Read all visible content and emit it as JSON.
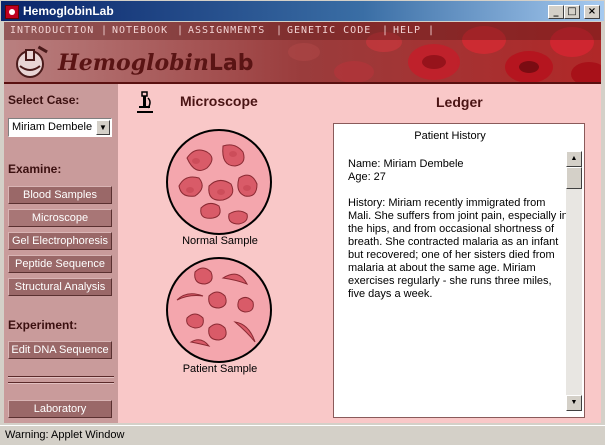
{
  "window": {
    "title": "HemoglobinLab",
    "minimize_glyph": "_",
    "maximize_glyph": "□",
    "close_glyph": "×"
  },
  "menu": [
    "INTRODUCTION",
    "NOTEBOOK",
    "ASSIGNMENTS",
    "GENETIC CODE",
    "HELP"
  ],
  "logo": {
    "main": "Hemoglobin",
    "suffix": "Lab",
    "icon": "microscope-flask-icon"
  },
  "sidebar": {
    "select_case_label": "Select Case:",
    "case_value": "Miriam Dembele",
    "examine_label": "Examine:",
    "examine_buttons": [
      "Blood Samples",
      "Microscope",
      "Gel Electrophoresis",
      "Peptide Sequence",
      "Structural Analysis"
    ],
    "experiment_label": "Experiment:",
    "experiment_button": "Edit DNA Sequence",
    "laboratory_button": "Laboratory"
  },
  "main": {
    "microscope_title": "Microscope",
    "microscope_icon": "microscope-icon",
    "normal_label": "Normal Sample",
    "patient_label": "Patient Sample"
  },
  "ledger": {
    "title": "Ledger",
    "heading": "Patient History",
    "name_line": "Name: Miriam Dembele",
    "age_line": "Age: 27",
    "history": "History: Miriam recently immigrated from Mali.  She suffers from joint pain, especially in the hips, and from occasional shortness of breath.  She contracted malaria as an infant but recovered; one of her sisters died from malaria at about the same age.  Miriam exercises regularly - she runs three miles, five days a week."
  },
  "status": "Warning: Applet Window",
  "colors": {
    "app_bg": "#f9c8c8",
    "sidebar_bg": "#c99b9b",
    "button_bg": "#9a6868",
    "header_bg": "#8a3030",
    "cell_fill": "#d95b68",
    "circle_fill": "#f4a6ad"
  }
}
